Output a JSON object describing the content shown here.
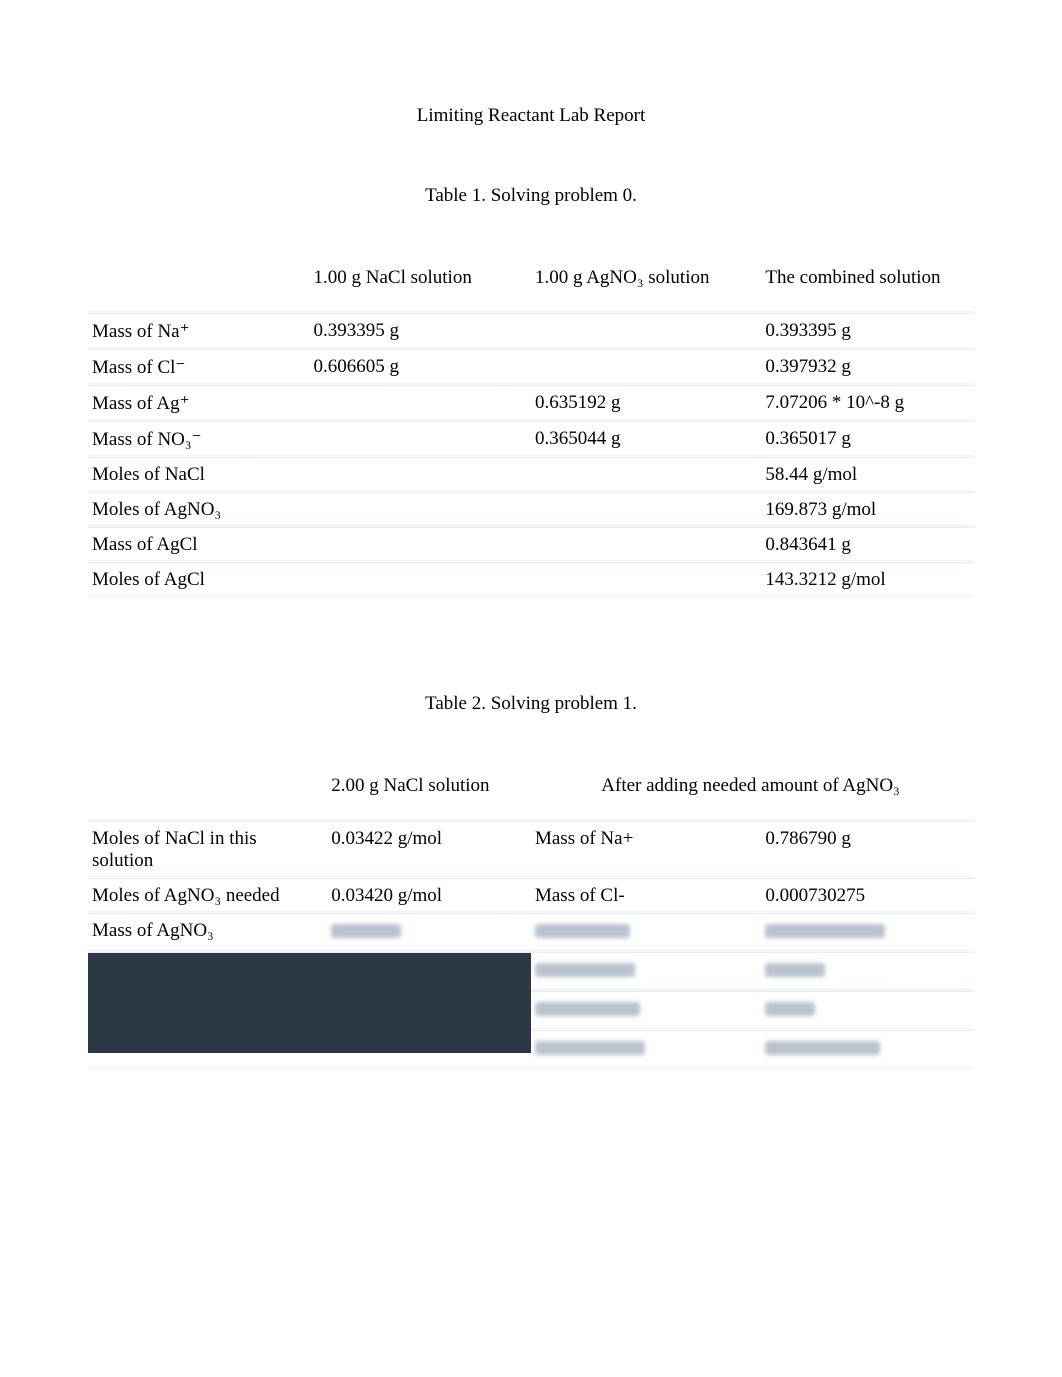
{
  "title": "Limiting Reactant Lab Report",
  "table1": {
    "caption": "Table 1. Solving problem 0.",
    "headers": {
      "col1": "",
      "col2": "1.00 g NaCl solution",
      "col3": "1.00 g AgNO₃ solution",
      "col4": "The combined solution"
    },
    "rows": [
      {
        "label": "Mass of Na⁺",
        "v2": "0.393395 g",
        "v3": "",
        "v4": "0.393395 g"
      },
      {
        "label": "Mass of Cl⁻",
        "v2": "0.606605 g",
        "v3": "",
        "v4": "0.397932 g"
      },
      {
        "label": "Mass of Ag⁺",
        "v2": "",
        "v3": "0.635192 g",
        "v4": "7.07206 * 10^-8 g"
      },
      {
        "label": "Mass of NO₃⁻",
        "v2": "",
        "v3": "0.365044 g",
        "v4": "0.365017 g"
      },
      {
        "label": "Moles of NaCl",
        "v2": "",
        "v3": "",
        "v4": "58.44 g/mol"
      },
      {
        "label": "Moles of AgNO₃",
        "v2": "",
        "v3": "",
        "v4": "169.873 g/mol"
      },
      {
        "label": "Mass of AgCl",
        "v2": "",
        "v3": "",
        "v4": "0.843641 g"
      },
      {
        "label": "Moles of AgCl",
        "v2": "",
        "v3": "",
        "v4": "143.3212 g/mol"
      }
    ]
  },
  "table2": {
    "caption": "Table 2. Solving problem 1.",
    "headers": {
      "col1": "",
      "col2": "2.00 g NaCl solution",
      "col34": "After adding needed amount of AgNO₃"
    },
    "rows": [
      {
        "label": "Moles of NaCl in this solution",
        "v2": "0.03422 g/mol",
        "v3": "Mass of Na+",
        "v4": "0.786790 g"
      },
      {
        "label": "Moles of AgNO₃ needed",
        "v2": "0.03420 g/mol",
        "v3": "Mass of Cl-",
        "v4": "0.000730275"
      },
      {
        "label": "Mass of AgNO₃",
        "v2": "",
        "v3": "",
        "v4": ""
      }
    ]
  }
}
